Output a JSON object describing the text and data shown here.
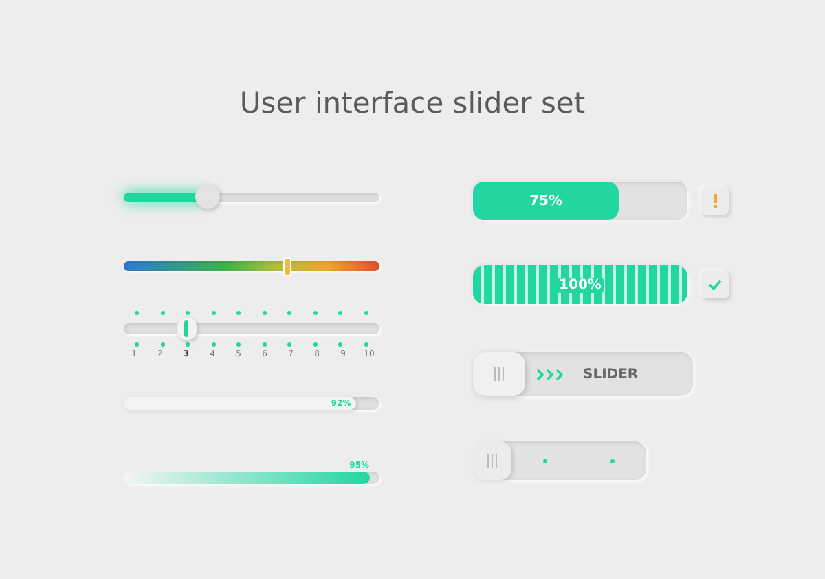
{
  "title": "User interface slider set",
  "left": [
    {
      "kind": "slider",
      "level": 0.33
    },
    {
      "kind": "gradient",
      "level": 0.64
    },
    {
      "kind": "steps",
      "steps": [
        {
          "label": "1",
          "selected": false
        },
        {
          "label": "2",
          "selected": false
        },
        {
          "label": "3",
          "selected": true
        },
        {
          "label": "4",
          "selected": false
        },
        {
          "label": "5",
          "selected": false
        },
        {
          "label": "6",
          "selected": false
        },
        {
          "label": "7",
          "selected": false
        },
        {
          "label": "8",
          "selected": false
        },
        {
          "label": "9",
          "selected": false
        },
        {
          "label": "10",
          "selected": false
        }
      ]
    },
    {
      "kind": "inline",
      "level": 0.91,
      "reading": "92%"
    },
    {
      "kind": "above",
      "level": 0.96,
      "reading": "95%"
    }
  ],
  "right": [
    {
      "kind": "bar",
      "reading": "75%",
      "complete": false
    },
    {
      "kind": "striped",
      "reading": "100%",
      "complete": true
    },
    {
      "kind": "swipe",
      "label": "SLIDER",
      "level": 0
    },
    {
      "kind": "segmented",
      "level": 0
    }
  ]
}
